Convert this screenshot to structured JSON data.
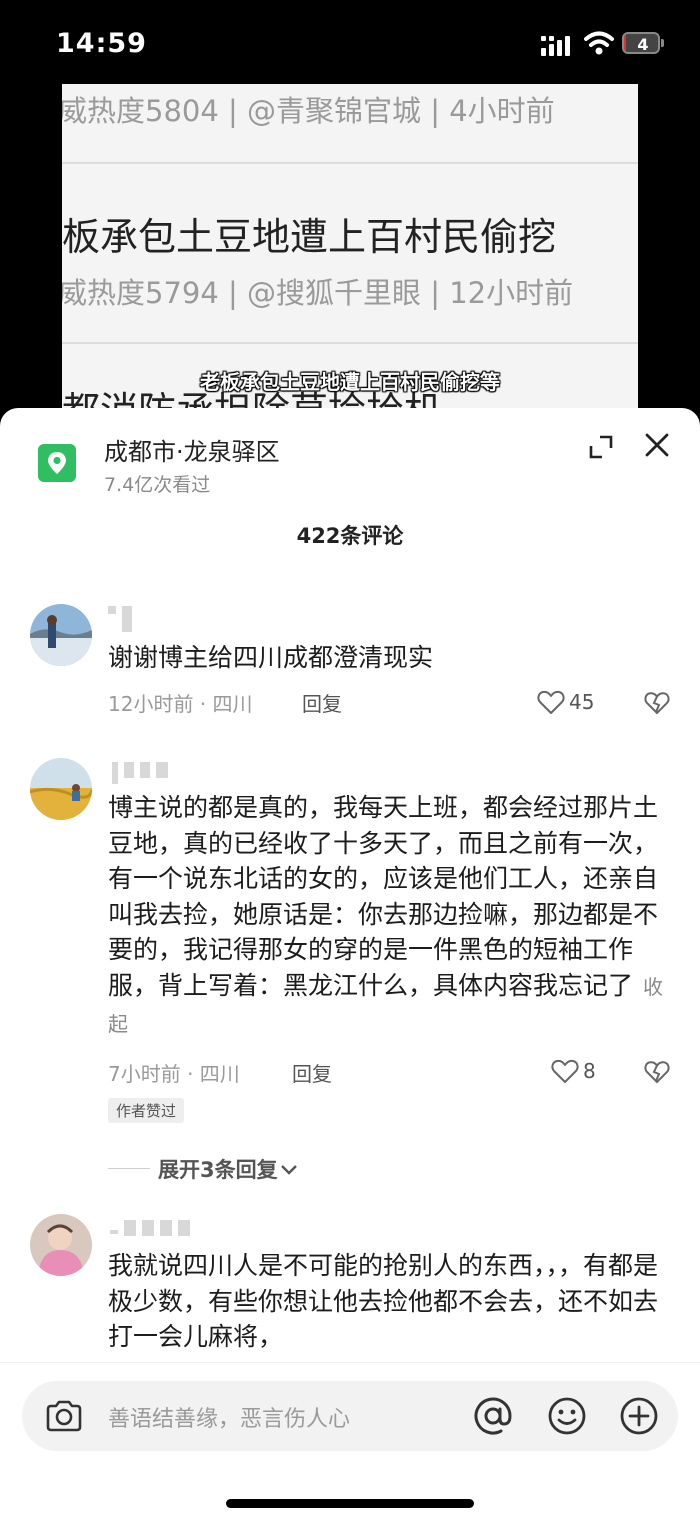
{
  "status_bar": {
    "time": "14:59",
    "battery": "4",
    "battery_level_percent": 4
  },
  "video": {
    "rows": [
      {
        "text": "威热度5804 | @青聚锦官城 | 4小时前"
      },
      {
        "text": "板承包土豆地遭上百村民偷挖"
      },
      {
        "text": "威热度5794 | @搜狐千里眼 | 12小时前"
      },
      {
        "text": "都消防承担除草捡拾机"
      }
    ],
    "subtitle": "老板承包土豆地遭上百村民偷挖等"
  },
  "sheet": {
    "location_title": "成都市·龙泉驿区",
    "location_views": "7.4亿次看过",
    "comment_count": "422条评论"
  },
  "comments": [
    {
      "text": "谢谢博主给四川成都澄清现实",
      "time_location": "12小时前 · 四川",
      "reply_label": "回复",
      "likes": "45"
    },
    {
      "text": "博主说的都是真的，我每天上班，都会经过那片土豆地，真的已经收了十多天了，而且之前有一次，有一个说东北话的女的，应该是他们工人，还亲自叫我去捡，她原话是：你去那边捡嘛，那边都是不要的，我记得那女的穿的是一件黑色的短袖工作服，背上写着：黑龙江什么，具体内容我忘记了",
      "fold_label": "收起",
      "time_location": "7小时前 · 四川",
      "reply_label": "回复",
      "likes": "8",
      "badge": "作者赞过",
      "expand_replies": "展开3条回复"
    },
    {
      "text": "我就说四川人是不可能的抢别人的东西，，，有都是极少数，有些你想让他去捡他都不会去，还不如去打一会儿麻将，"
    }
  ],
  "input": {
    "placeholder": "善语结善缘，恶言伤人心"
  },
  "colors": {
    "location_green": "#2fbf62",
    "battery_red": "#dd3333"
  }
}
